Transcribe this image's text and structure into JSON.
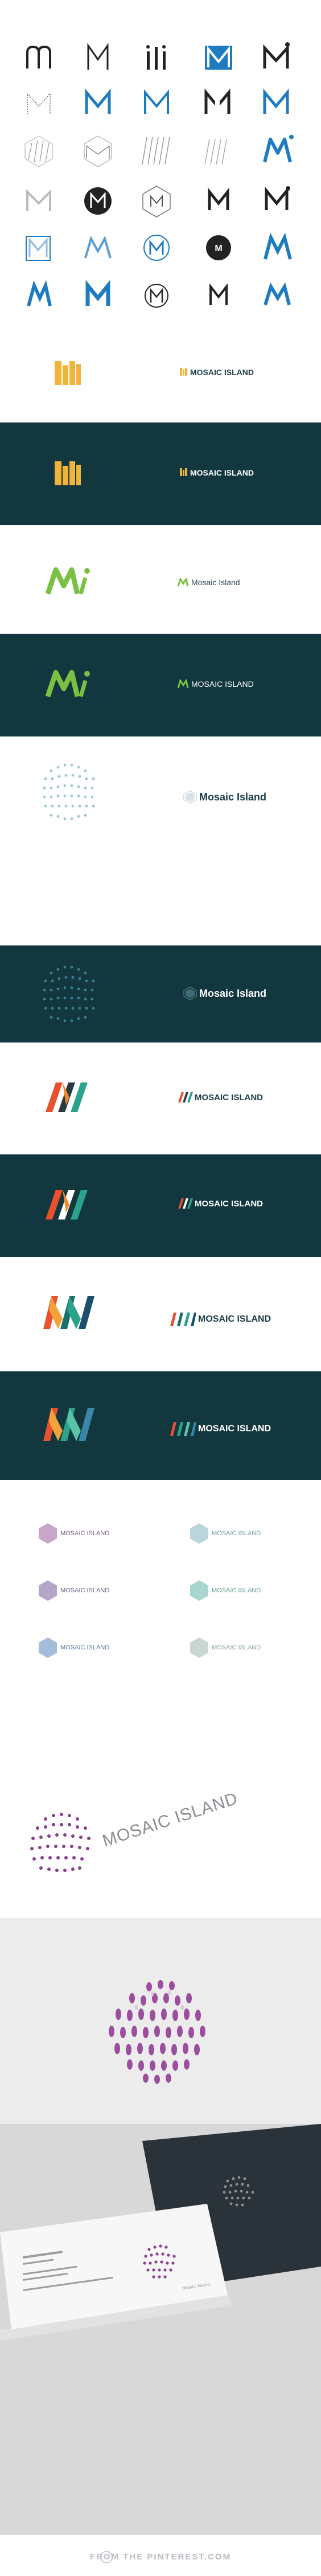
{
  "sections": {
    "grid_caption": "",
    "s1": {
      "caption": "",
      "wordmark": "MOSAIC ISLAND"
    },
    "s2": {
      "caption": "",
      "wordmark": "MOSAIC ISLAND"
    },
    "s3": {
      "caption": "",
      "wordmark": "Mosaic Island"
    },
    "s4": {
      "caption": "",
      "wordmark": "MOSAIC ISLAND"
    },
    "s5": {
      "caption": "",
      "wordmark": "MOSAIC ISLAND"
    },
    "s6": {
      "caption": "",
      "wordmark": "MOSAIC ISLAND"
    },
    "hero": {
      "caption": "",
      "wordmark": "MOSAIC ISLAND"
    },
    "card": {
      "label": "Mosaic Island"
    }
  },
  "colors": {
    "teal_bg": "#12373f",
    "gold": "#f0b43a",
    "green": "#7ac143",
    "blue": "#1e7bbf",
    "purple": "#8a3f8f"
  },
  "footer": {
    "text": "FROM THE PINTEREST.COM"
  }
}
